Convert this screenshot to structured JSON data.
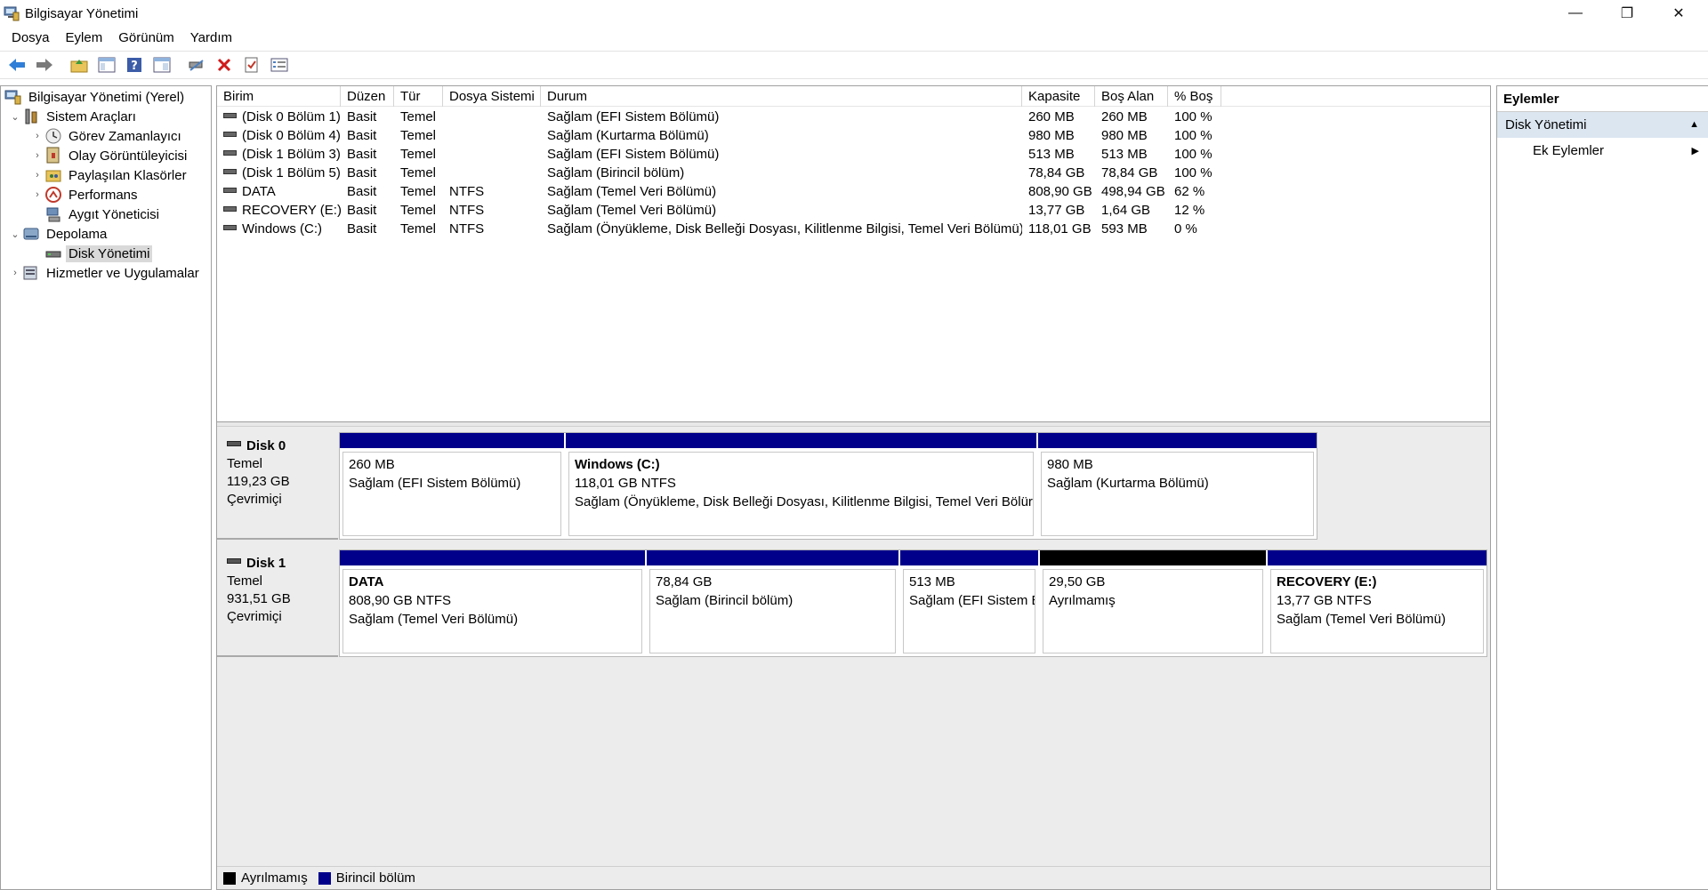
{
  "window": {
    "title": "Bilgisayar Yönetimi",
    "controls": {
      "minimize": "—",
      "restore": "❐",
      "close": "✕"
    }
  },
  "menu": [
    "Dosya",
    "Eylem",
    "Görünüm",
    "Yardım"
  ],
  "toolbar": [
    {
      "icon": "back-arrow-icon"
    },
    {
      "icon": "forward-arrow-icon"
    },
    {
      "icon": "up-folder-icon"
    },
    {
      "icon": "show-hide-tree-icon"
    },
    {
      "icon": "help-icon"
    },
    {
      "icon": "properties-view-icon"
    },
    {
      "icon": "connect-drive-icon"
    },
    {
      "icon": "delete-icon"
    },
    {
      "icon": "check-icon"
    },
    {
      "icon": "settings-list-icon"
    }
  ],
  "tree": {
    "root": "Bilgisayar Yönetimi (Yerel)",
    "items": [
      {
        "label": "Sistem Araçları",
        "expander": "⌄",
        "icon": "tools-icon"
      },
      {
        "label": "Görev Zamanlayıcı",
        "expander": "›",
        "icon": "clock-icon"
      },
      {
        "label": "Olay Görüntüleyicisi",
        "expander": "›",
        "icon": "event-viewer-icon"
      },
      {
        "label": "Paylaşılan Klasörler",
        "expander": "›",
        "icon": "shared-folder-icon"
      },
      {
        "label": "Performans",
        "expander": "›",
        "icon": "performance-icon"
      },
      {
        "label": "Aygıt Yöneticisi",
        "expander": "",
        "icon": "device-manager-icon"
      },
      {
        "label": "Depolama",
        "expander": "⌄",
        "icon": "storage-icon"
      },
      {
        "label": "Disk Yönetimi",
        "expander": "",
        "icon": "disk-management-icon"
      },
      {
        "label": "Hizmetler ve Uygulamalar",
        "expander": "›",
        "icon": "services-icon"
      }
    ]
  },
  "volumes": {
    "columns": [
      "Birim",
      "Düzen",
      "Tür",
      "Dosya Sistemi",
      "Durum",
      "Kapasite",
      "Boş Alan",
      "% Boş"
    ],
    "rows": [
      [
        "(Disk 0 Bölüm 1)",
        "Basit",
        "Temel",
        "",
        "Sağlam (EFI Sistem Bölümü)",
        "260 MB",
        "260 MB",
        "100 %"
      ],
      [
        "(Disk 0 Bölüm 4)",
        "Basit",
        "Temel",
        "",
        "Sağlam (Kurtarma Bölümü)",
        "980 MB",
        "980 MB",
        "100 %"
      ],
      [
        "(Disk 1 Bölüm 3)",
        "Basit",
        "Temel",
        "",
        "Sağlam (EFI Sistem Bölümü)",
        "513 MB",
        "513 MB",
        "100 %"
      ],
      [
        "(Disk 1 Bölüm 5)",
        "Basit",
        "Temel",
        "",
        "Sağlam (Birincil bölüm)",
        "78,84 GB",
        "78,84 GB",
        "100 %"
      ],
      [
        "DATA",
        "Basit",
        "Temel",
        "NTFS",
        "Sağlam (Temel Veri Bölümü)",
        "808,90 GB",
        "498,94 GB",
        "62 %"
      ],
      [
        "RECOVERY (E:)",
        "Basit",
        "Temel",
        "NTFS",
        "Sağlam (Temel Veri Bölümü)",
        "13,77 GB",
        "1,64 GB",
        "12 %"
      ],
      [
        "Windows (C:)",
        "Basit",
        "Temel",
        "NTFS",
        "Sağlam (Önyükleme, Disk Belleği Dosyası, Kilitlenme Bilgisi, Temel Veri Bölümü)",
        "118,01 GB",
        "593 MB",
        "0 %"
      ]
    ]
  },
  "disks": [
    {
      "name": "Disk 0",
      "type": "Temel",
      "size": "119,23 GB",
      "status": "Çevrimiçi",
      "partitions": [
        {
          "name": "",
          "size": "260 MB",
          "status": "Sağlam (EFI Sistem Bölümü)",
          "kind": "primary"
        },
        {
          "name": "Windows  (C:)",
          "size": "118,01 GB NTFS",
          "status": "Sağlam (Önyükleme, Disk Belleği Dosyası, Kilitlenme Bilgisi, Temel Veri Bölür",
          "kind": "primary"
        },
        {
          "name": "",
          "size": "980 MB",
          "status": "Sağlam (Kurtarma Bölümü)",
          "kind": "primary"
        }
      ]
    },
    {
      "name": "Disk 1",
      "type": "Temel",
      "size": "931,51 GB",
      "status": "Çevrimiçi",
      "partitions": [
        {
          "name": "DATA",
          "size": "808,90 GB NTFS",
          "status": "Sağlam (Temel Veri Bölümü)",
          "kind": "primary"
        },
        {
          "name": "",
          "size": "78,84 GB",
          "status": "Sağlam (Birincil bölüm)",
          "kind": "primary"
        },
        {
          "name": "",
          "size": "513 MB",
          "status": "Sağlam (EFI Sistem B",
          "kind": "primary"
        },
        {
          "name": "",
          "size": "29,50 GB",
          "status": "Ayrılmamış",
          "kind": "unallocated"
        },
        {
          "name": "RECOVERY  (E:)",
          "size": "13,77 GB NTFS",
          "status": "Sağlam (Temel Veri Bölümü)",
          "kind": "primary"
        }
      ]
    }
  ],
  "legend": [
    {
      "label": "Ayrılmamış",
      "color": "#000000"
    },
    {
      "label": "Birincil bölüm",
      "color": "#00008b"
    }
  ],
  "actions": {
    "title": "Eylemler",
    "section": "Disk Yönetimi",
    "more": "Ek Eylemler",
    "section_arrow": "▲",
    "more_arrow": "▶"
  },
  "colors": {
    "primary_partition": "#00008b",
    "unallocated": "#000000",
    "selection": "#dbe6f1"
  }
}
